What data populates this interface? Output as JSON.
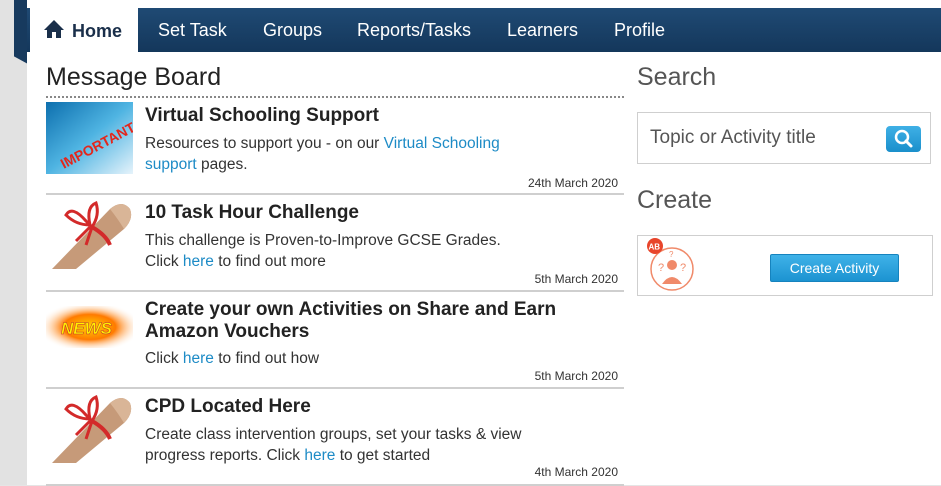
{
  "nav": {
    "items": [
      {
        "label": "Home",
        "active": true
      },
      {
        "label": "Set Task"
      },
      {
        "label": "Groups"
      },
      {
        "label": "Reports/Tasks"
      },
      {
        "label": "Learners"
      },
      {
        "label": "Profile"
      }
    ]
  },
  "message_board": {
    "title": "Message Board",
    "messages": [
      {
        "title": "Virtual Schooling Support",
        "body_pre": "Resources to support you - on our ",
        "link": "Virtual Schooling support",
        "body_post": " pages.",
        "date": "24th March 2020",
        "thumb_text": "IMPORTANT"
      },
      {
        "title": "10 Task Hour Challenge",
        "line1": "This challenge is Proven-to-Improve GCSE Grades.",
        "body_pre": "Click ",
        "link": "here",
        "body_post": " to find out more",
        "date": "5th March 2020"
      },
      {
        "title": "Create your own Activities on Share and Earn Amazon Vouchers",
        "body_pre": "Click ",
        "link": "here",
        "body_post": " to find out how",
        "date": "5th March 2020",
        "thumb_text": "NEWS"
      },
      {
        "title": "CPD Located Here",
        "line1": "Create class intervention groups, set your tasks & view",
        "body_pre": "progress reports. Click ",
        "link": "here",
        "body_post": " to get started",
        "date": "4th March 2020"
      }
    ]
  },
  "search": {
    "title": "Search",
    "placeholder": "Topic or Activity title",
    "button_icon": "magnifier-icon"
  },
  "create": {
    "title": "Create",
    "icon_badge": "AB",
    "button_label": "Create Activity"
  },
  "colors": {
    "nav_bg": "#1a4068",
    "link": "#1d8bc6",
    "button": "#1c93d1"
  }
}
